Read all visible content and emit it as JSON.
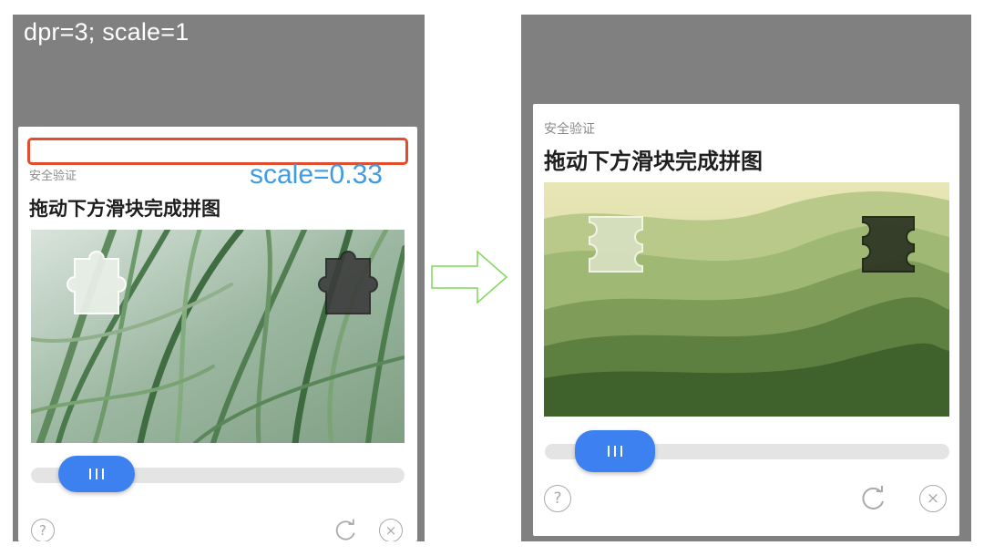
{
  "left": {
    "overlay_label": "dpr=3; scale=1",
    "scale_label": "scale=0.33",
    "captcha": {
      "subtitle": "安全验证",
      "title": "拖动下方滑块完成拼图",
      "slider_progress": 0.15
    },
    "icons": {
      "help": "question-mark",
      "refresh": "refresh",
      "close": "close-x"
    }
  },
  "right": {
    "captcha": {
      "subtitle": "安全验证",
      "title": "拖动下方滑块完成拼图",
      "slider_progress": 0.11
    },
    "icons": {
      "help": "question-mark",
      "refresh": "refresh",
      "close": "close-x"
    }
  },
  "glyphs": {
    "help": "?",
    "close": "×"
  },
  "colors": {
    "panel_background": "#808080",
    "slider_handle": "#3d80f0",
    "slider_track": "#e4e4e4",
    "highlight_box": "#e34d2e",
    "scale_label": "#3e9be5",
    "arrow_outline": "#7ed957"
  }
}
